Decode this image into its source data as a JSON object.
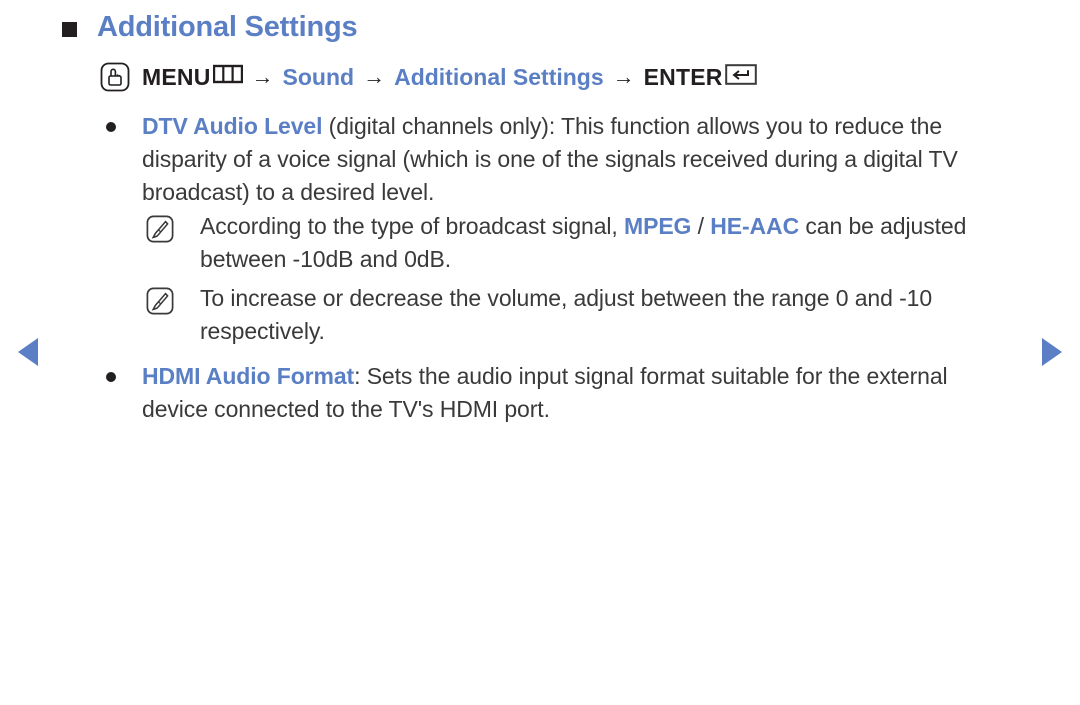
{
  "page": {
    "title": "Additional Settings",
    "title_marker": "square-bullet",
    "accent_color": "#5b7fc4",
    "text_color": "#3a3a3a",
    "marker_color": "#231f20"
  },
  "menu_path": {
    "remote_icon": "oo-touch-button-icon",
    "menu_label": "MENU",
    "menu_icon": "menu-grid-icon",
    "arrow": "→",
    "step_sound": "Sound",
    "step_additional_settings": "Additional Settings",
    "enter_label": "ENTER",
    "enter_icon": "enter-return-key-icon"
  },
  "content": {
    "bullets": [
      {
        "keyword": "DTV Audio Level",
        "text": " (digital channels only): This function allows you to reduce the disparity of a voice signal (which is one of the signals received during a digital TV broadcast) to a desired level.",
        "notes": [
          {
            "icon": "note-pencil-icon",
            "prefix": "According to the type of broadcast signal, ",
            "keyword1": "MPEG",
            "separator": " / ",
            "keyword2": "HE-AAC",
            "suffix": " can be adjusted between -10dB and 0dB."
          },
          {
            "icon": "note-pencil-icon",
            "prefix": "To increase or decrease the volume, adjust between the range 0 and -10 respectively.",
            "keyword1": "",
            "separator": "",
            "keyword2": "",
            "suffix": ""
          }
        ]
      },
      {
        "keyword": "HDMI Audio Format",
        "text": ": Sets the audio input signal format suitable for the external device connected to the TV's HDMI port.",
        "notes": []
      }
    ]
  },
  "navigation": {
    "prev_label": "previous-page-arrow",
    "next_label": "next-page-arrow"
  }
}
